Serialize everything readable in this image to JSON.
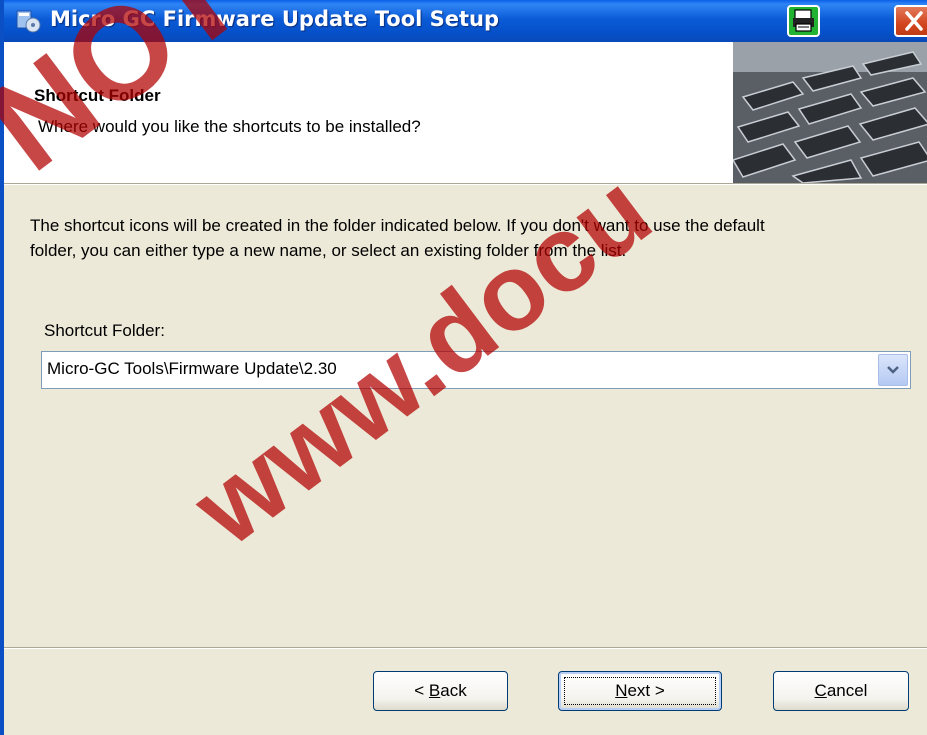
{
  "window": {
    "title": "Micro GC Firmware Update Tool Setup",
    "icons": {
      "app": "setup-icon",
      "print": "printer-icon",
      "close": "close-icon"
    },
    "colors": {
      "titlebar": "#0550c9",
      "print_button": "#22b333",
      "close_button": "#d2461e"
    }
  },
  "header": {
    "title": "Shortcut Folder",
    "subtitle": "Where would you like the shortcuts to be installed?",
    "image": "keyboard-image"
  },
  "body": {
    "description_line1": "The shortcut icons will be created in the folder indicated below. If you don't want to use the default",
    "description_line2": "folder, you can either type a new name, or select an existing folder from the list.",
    "folder_label": "Shortcut Folder:",
    "folder_value": "Micro-GC Tools\\Firmware Update\\2.30",
    "dropdown_icon": "chevron-down-icon"
  },
  "buttons": {
    "back": {
      "mnemonic": "B",
      "rest": "ack",
      "prefix": "< "
    },
    "next": {
      "mnemonic": "N",
      "rest": "ext >"
    },
    "cancel": {
      "mnemonic": "C",
      "rest": "ancel"
    }
  },
  "watermark": {
    "line1": "NOT Un",
    "line2": "www.docu",
    "color": "#b20000"
  }
}
